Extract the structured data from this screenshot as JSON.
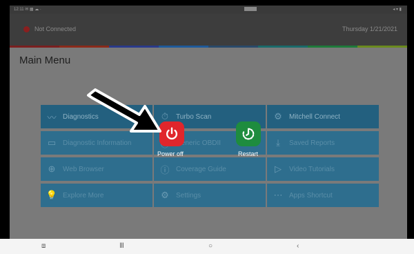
{
  "statusbar": {
    "left_text": "12:11 ✉ ▦ ☁ ·",
    "right_text": "◂ ▾ ▮"
  },
  "header": {
    "connection": "Not Connected",
    "date": "Thursday 1/21/2021"
  },
  "stripe_colors": [
    "#7a1f1f",
    "#8a2a1a",
    "#2a3a8a",
    "#1f5a9a",
    "#2a4a6a",
    "#1a6a6a",
    "#1e7a3a",
    "#6a8a1e"
  ],
  "main": {
    "title": "Main Menu",
    "tiles": [
      {
        "label": "Diagnostics",
        "icon": "diagnostics-icon",
        "glyph": "〰"
      },
      {
        "label": "Turbo Scan",
        "icon": "turbo-scan-icon",
        "glyph": "⏱"
      },
      {
        "label": "Mitchell Connect",
        "icon": "mitchell-connect-icon",
        "glyph": "⚙"
      },
      {
        "label": "Diagnostic Information",
        "icon": "diagnostic-info-icon",
        "glyph": "▭"
      },
      {
        "label": "Generic OBDII",
        "icon": "obd-icon",
        "glyph": "Ⓞ"
      },
      {
        "label": "Saved Reports",
        "icon": "saved-reports-icon",
        "glyph": "⤓"
      },
      {
        "label": "Web Browser",
        "icon": "web-browser-icon",
        "glyph": "⊕"
      },
      {
        "label": "Coverage Guide",
        "icon": "coverage-guide-icon",
        "glyph": "ⓘ"
      },
      {
        "label": "Video Tutorials",
        "icon": "video-tutorials-icon",
        "glyph": "▷"
      },
      {
        "label": "Explore More",
        "icon": "explore-more-icon",
        "glyph": "💡"
      },
      {
        "label": "Settings",
        "icon": "settings-icon",
        "glyph": "⚙"
      },
      {
        "label": "Apps Shortcut",
        "icon": "apps-shortcut-icon",
        "glyph": "⋯"
      }
    ]
  },
  "power_menu": {
    "power_off_label": "Power off",
    "restart_label": "Restart",
    "power_color": "#e0262c",
    "restart_color": "#1e8c3e"
  },
  "navbar": {
    "recent": "⧈",
    "home": "Ⅲ",
    "circle": "○",
    "back": "‹"
  }
}
